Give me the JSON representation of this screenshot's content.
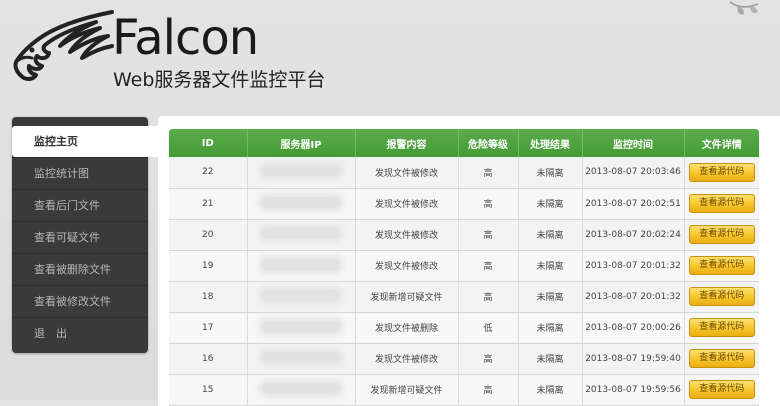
{
  "brand": {
    "title": "Falcon",
    "subtitle": "Web服务器文件监控平台"
  },
  "sidebar": {
    "items": [
      {
        "label": "监控主页",
        "active": true
      },
      {
        "label": "监控统计图",
        "active": false
      },
      {
        "label": "查看后门文件",
        "active": false
      },
      {
        "label": "查看可疑文件",
        "active": false
      },
      {
        "label": "查看被删除文件",
        "active": false
      },
      {
        "label": "查看被修改文件",
        "active": false
      },
      {
        "label": "退　出",
        "active": false
      }
    ]
  },
  "table": {
    "columns": [
      "ID",
      "服务器IP",
      "报警内容",
      "危险等级",
      "处理结果",
      "监控时间",
      "文件详情"
    ],
    "rows": [
      {
        "id": "22",
        "alert": "发现文件被修改",
        "level": "高",
        "result": "未隔离",
        "time": "2013-08-07 20:03:46",
        "action": "查看源代码"
      },
      {
        "id": "21",
        "alert": "发现文件被修改",
        "level": "高",
        "result": "未隔离",
        "time": "2013-08-07 20:02:51",
        "action": "查看源代码"
      },
      {
        "id": "20",
        "alert": "发现文件被修改",
        "level": "高",
        "result": "未隔离",
        "time": "2013-08-07 20:02:24",
        "action": "查看源代码"
      },
      {
        "id": "19",
        "alert": "发现文件被修改",
        "level": "高",
        "result": "未隔离",
        "time": "2013-08-07 20:01:32",
        "action": "查看源代码"
      },
      {
        "id": "18",
        "alert": "发现新增可疑文件",
        "level": "高",
        "result": "未隔离",
        "time": "2013-08-07 20:01:32",
        "action": "查看源代码"
      },
      {
        "id": "17",
        "alert": "发现文件被删除",
        "level": "低",
        "result": "未隔离",
        "time": "2013-08-07 20:00:26",
        "action": "查看源代码"
      },
      {
        "id": "16",
        "alert": "发现文件被修改",
        "level": "高",
        "result": "未隔离",
        "time": "2013-08-07 19:59:40",
        "action": "查看源代码"
      },
      {
        "id": "15",
        "alert": "发现新增可疑文件",
        "level": "高",
        "result": "未隔离",
        "time": "2013-08-07 19:59:56",
        "action": "查看源代码"
      }
    ]
  },
  "colors": {
    "header_green": "#4ea340",
    "sidebar_bg": "#3a3a3a",
    "button_yellow": "#f6c42a"
  },
  "icons": {
    "logo": "falcon-head-icon",
    "decoration": "leaf-icon"
  }
}
